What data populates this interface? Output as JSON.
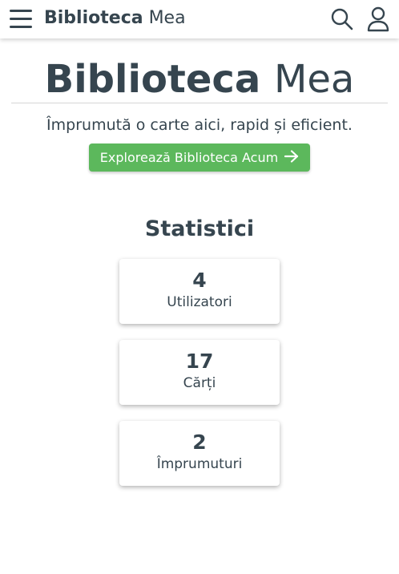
{
  "navbar": {
    "brand_bold": "Biblioteca",
    "brand_light": "Mea",
    "menu_icon": "hamburger-menu-icon",
    "search_icon": "search-icon",
    "user_icon": "user-icon"
  },
  "hero": {
    "title_bold": "Biblioteca",
    "title_light": "Mea",
    "subtitle": "Împrumută o carte aici, rapid și eficient.",
    "cta_label": "Explorează Biblioteca Acum",
    "cta_icon": "arrow-right-icon"
  },
  "stats": {
    "title": "Statistici",
    "items": [
      {
        "value": "4",
        "label": "Utilizatori"
      },
      {
        "value": "17",
        "label": "Cărți"
      },
      {
        "value": "2",
        "label": "Împrumuturi"
      }
    ]
  },
  "colors": {
    "text": "#36454f",
    "accent": "#5cb85c",
    "background": "#ffffff"
  }
}
